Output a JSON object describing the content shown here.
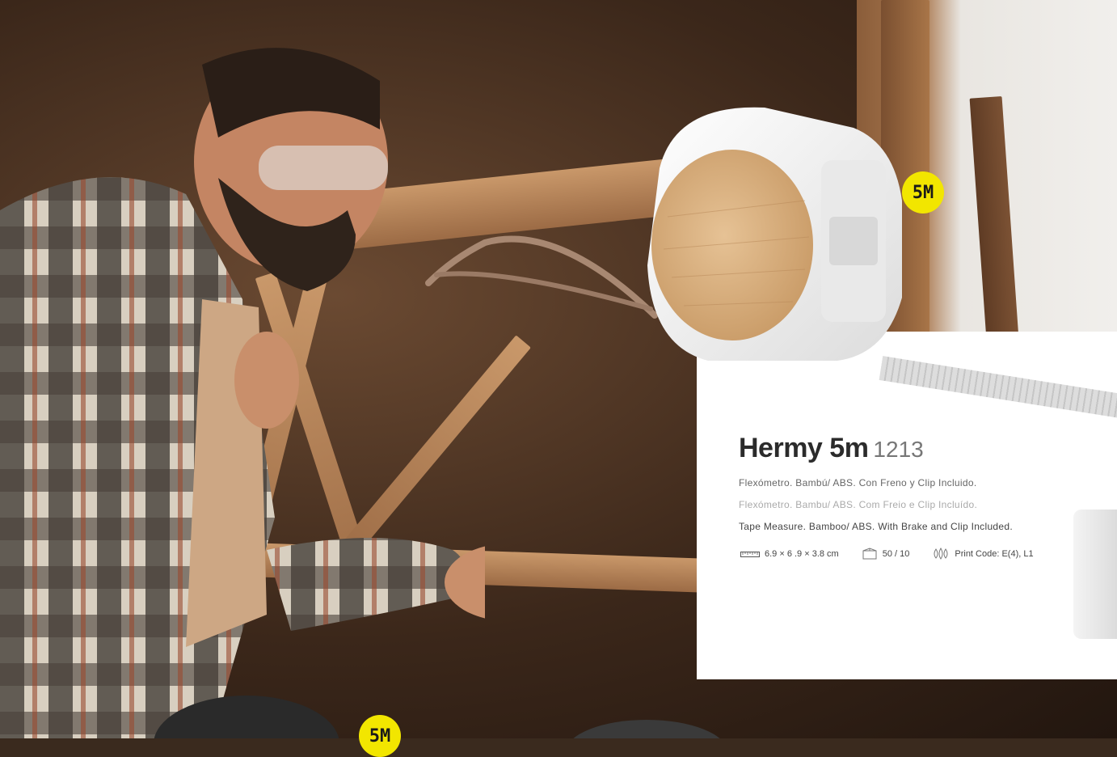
{
  "product": {
    "name": "Hermy 5m",
    "code": "1213",
    "desc_es": "Flexómetro. Bambú/ ABS. Con Freno y Clip Incluido.",
    "desc_pt": "Flexómetro. Bambu/ ABS. Com Freio e Clip Incluído.",
    "desc_en": "Tape Measure. Bamboo/ ABS. With Brake and Clip Included.",
    "dimensions": "6.9 × 6 .9 × 3.8 cm",
    "packaging": "50 / 10",
    "print_code": "Print Code: E(4), L1"
  },
  "badges": {
    "main": "5M",
    "bottom": "5M"
  },
  "icons": {
    "dimensions": "ruler-icon",
    "packaging": "box-icon",
    "print": "print-drops-icon"
  },
  "colors": {
    "badge": "#f2e600",
    "card": "#ffffff",
    "title": "#2b2b2b"
  }
}
